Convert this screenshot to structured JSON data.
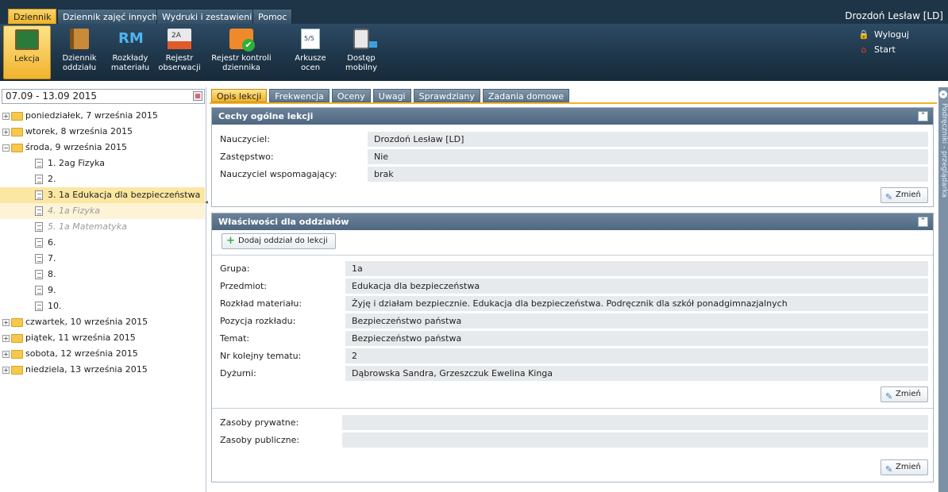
{
  "menu": {
    "tabs": [
      "Dziennik",
      "Dziennik zajęć innych",
      "Wydruki i zestawienia",
      "Pomoc"
    ],
    "user": "Drozdoń Lesław [LD]"
  },
  "ribbon": {
    "buttons": [
      {
        "line1": "Lekcja",
        "line2": ""
      },
      {
        "line1": "Dziennik",
        "line2": "oddziału"
      },
      {
        "line1": "Rozkłady",
        "line2": "materiału"
      },
      {
        "line1": "Rejestr",
        "line2": "obserwacji"
      },
      {
        "line1": "Rejestr kontroli",
        "line2": "dziennika"
      },
      {
        "line1": "Arkusze",
        "line2": "ocen"
      },
      {
        "line1": "Dostęp",
        "line2": "mobilny"
      }
    ],
    "rm_text": "RM",
    "logout": "Wyloguj",
    "start": "Start"
  },
  "left": {
    "week": "07.09 - 13.09 2015",
    "days": [
      "poniedziałek, 7 września 2015",
      "wtorek, 8 września 2015",
      "środa, 9 września 2015",
      "czwartek, 10 września 2015",
      "piątek, 11 września 2015",
      "sobota, 12 września 2015",
      "niedziela, 13 września 2015"
    ],
    "lessons": [
      "1. 2ag Fizyka",
      "2.",
      "3. 1a Edukacja dla bezpieczeństwa",
      "4. 1a Fizyka",
      "5. 1a Matematyka",
      "6.",
      "7.",
      "8.",
      "9.",
      "10."
    ]
  },
  "tabs": [
    "Opis lekcji",
    "Frekwencja",
    "Oceny",
    "Uwagi",
    "Sprawdziany",
    "Zadania domowe"
  ],
  "general": {
    "title": "Cechy ogólne lekcji",
    "teacher_label": "Nauczyciel:",
    "teacher_value": "Drozdoń Lesław [LD]",
    "sub_label": "Zastępstwo:",
    "sub_value": "Nie",
    "assist_label": "Nauczyciel wspomagający:",
    "assist_value": "brak",
    "change": "Zmień"
  },
  "props": {
    "title": "Właściwości dla oddziałów",
    "add": "Dodaj oddział do lekcji",
    "fields": [
      {
        "label": "Grupa:",
        "value": "1a"
      },
      {
        "label": "Przedmiot:",
        "value": "Edukacja dla bezpieczeństwa"
      },
      {
        "label": "Rozkład materiału:",
        "value": "Żyję i działam bezpiecznie. Edukacja dla bezpieczeństwa. Podręcznik dla szkół ponadgimnazjalnych"
      },
      {
        "label": "Pozycja rozkładu:",
        "value": "Bezpieczeństwo państwa"
      },
      {
        "label": "Temat:",
        "value": "Bezpieczeństwo państwa"
      },
      {
        "label": "Nr kolejny tematu:",
        "value": "2"
      },
      {
        "label": "Dyżurni:",
        "value": "Dąbrowska Sandra, Grzeszczuk Ewelina Kinga"
      }
    ],
    "change": "Zmień",
    "private_label": "Zasoby prywatne:",
    "public_label": "Zasoby publiczne:",
    "change2": "Zmień"
  },
  "sidebar": {
    "text": "Podręczniki - przeglądarka"
  }
}
